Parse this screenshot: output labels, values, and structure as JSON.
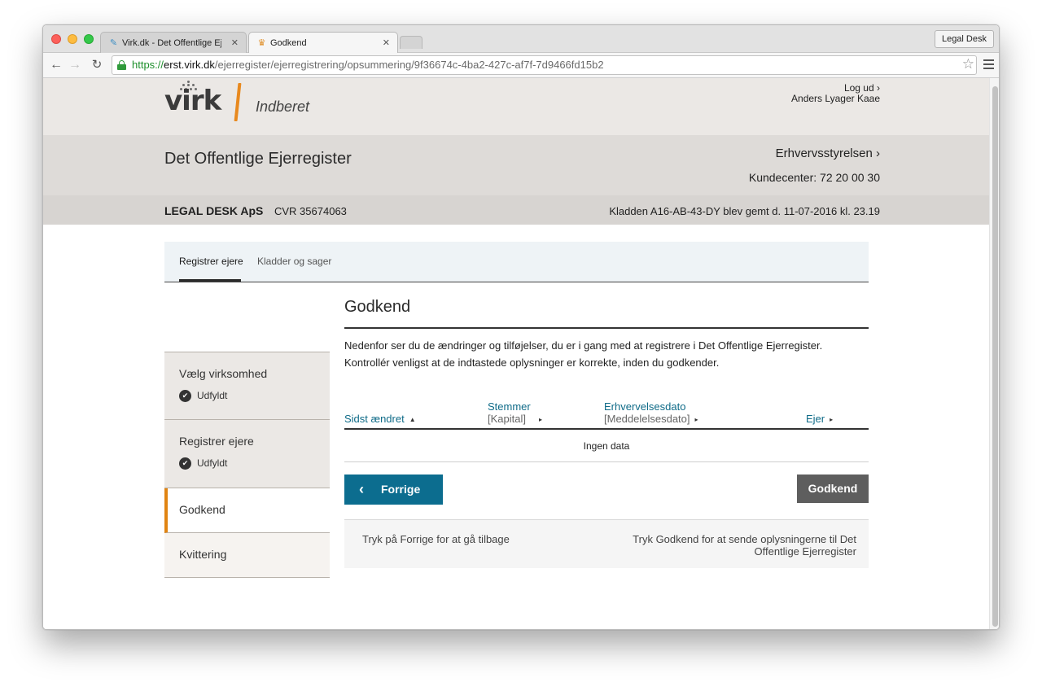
{
  "browser": {
    "tabs": [
      {
        "title": "Virk.dk - Det Offentlige Ejerregister",
        "active": false
      },
      {
        "title": "Godkend",
        "active": true
      }
    ],
    "profile_button": "Legal Desk",
    "url": {
      "scheme": "https://",
      "host": "erst.virk.dk",
      "path": "/ejerregister/ejerregistrering/opsummering/9f36674c-4ba2-427c-af7f-7d9466fd15b2"
    }
  },
  "header": {
    "logo_word": "virk",
    "logo_sub": "Indberet",
    "logout": "Log ud ›",
    "user_name": "Anders Lyager Kaae",
    "register_title": "Det Offentlige Ejerregister",
    "agency_link": "Erhvervsstyrelsen ›",
    "customer_center": "Kundecenter: 72 20 00 30",
    "company_name": "LEGAL DESK ApS",
    "company_cvr": "CVR 35674063",
    "draft_status": "Kladden A16-AB-43-DY blev gemt d. 11-07-2016 kl. 23.19"
  },
  "section_tabs": [
    {
      "label": "Registrer ejere",
      "active": true
    },
    {
      "label": "Kladder og sager",
      "active": false
    }
  ],
  "steps": [
    {
      "label": "Vælg virksomhed",
      "status": "Udfyldt"
    },
    {
      "label": "Registrer ejere",
      "status": "Udfyldt"
    },
    {
      "label": "Godkend",
      "status": ""
    },
    {
      "label": "Kvittering",
      "status": ""
    }
  ],
  "main": {
    "title": "Godkend",
    "intro_line1": "Nedenfor ser du de ændringer og tilføjelser, du er i gang med at registrere i Det Offentlige Ejerregister.",
    "intro_line2": "Kontrollér venligst at de indtastede oplysninger er korrekte, inden du godkender.",
    "table": {
      "columns": [
        {
          "label": "Sidst ændret",
          "sub": "",
          "sort": "ascending"
        },
        {
          "label": "Stemmer",
          "sub": "[Kapital]",
          "sort": "none"
        },
        {
          "label": "Erhvervelsesdato",
          "sub": "[Meddelelsesdato]",
          "sort": "none"
        },
        {
          "label": "Ejer",
          "sub": "",
          "sort": "none"
        }
      ],
      "empty_text": "Ingen data",
      "rows": []
    },
    "prev_button": "Forrige",
    "approve_button": "Godkend",
    "help_left": "Tryk på Forrige for at gå tilbage",
    "help_right": "Tryk Godkend for at sende oplysningerne til Det Offentlige Ejerregister"
  },
  "colors": {
    "accent_orange": "#e08412",
    "primary_button": "#0c6d8f",
    "secondary_button": "#5e5e5e",
    "link_blue": "#0f6b88"
  }
}
